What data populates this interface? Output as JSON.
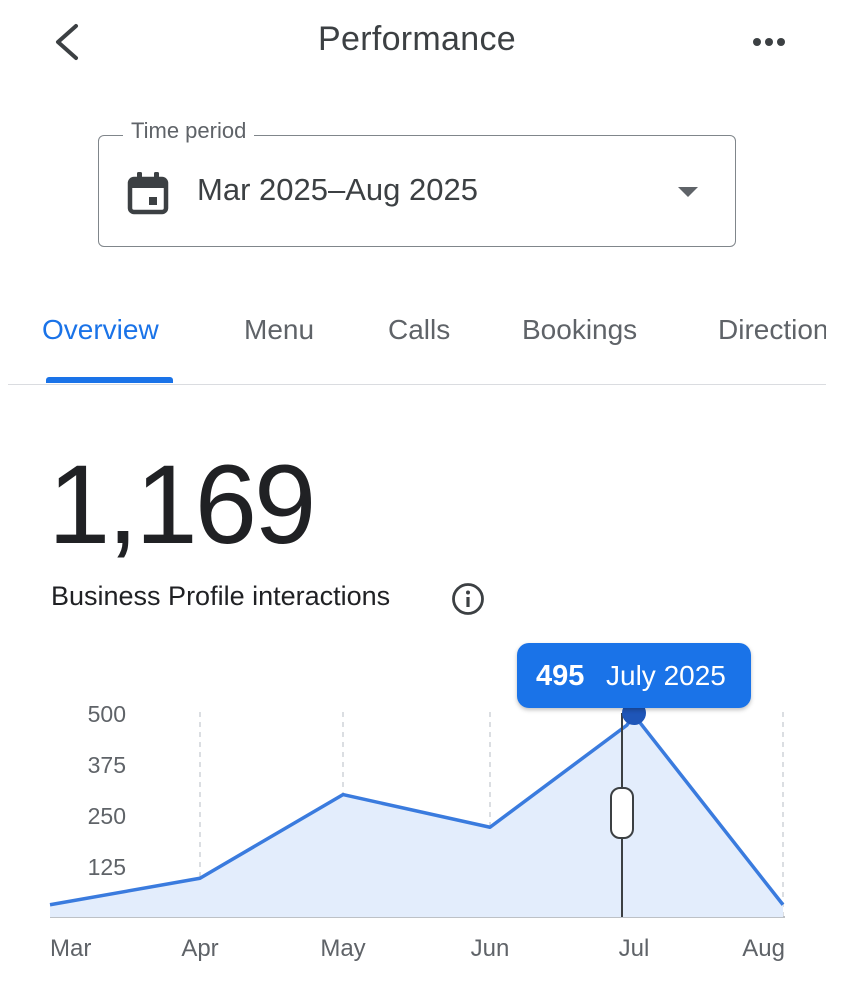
{
  "header": {
    "title": "Performance",
    "back_icon": "chevron-left-icon",
    "more_icon": "more-horizontal-icon"
  },
  "time_period": {
    "label": "Time period",
    "value": "Mar 2025–Aug 2025",
    "icon": "calendar-icon",
    "dropdown_icon": "arrow-drop-down-icon"
  },
  "tabs": [
    {
      "label": "Overview",
      "active": true
    },
    {
      "label": "Menu",
      "active": false
    },
    {
      "label": "Calls",
      "active": false
    },
    {
      "label": "Bookings",
      "active": false
    },
    {
      "label": "Directions",
      "active": false
    }
  ],
  "metric": {
    "value": "1,169",
    "label": "Business Profile interactions",
    "info_icon": "info-icon"
  },
  "tooltip": {
    "value": "495",
    "label": "July 2025"
  },
  "colors": {
    "accent": "#1a73e8",
    "line": "#3a7bde",
    "area": "#e3edfc",
    "grid": "#cfd3d8"
  },
  "chart_data": {
    "type": "area",
    "categories": [
      "Mar",
      "Apr",
      "May",
      "Jun",
      "Jul",
      "Aug"
    ],
    "y_ticks": [
      "500",
      "375",
      "250",
      "125"
    ],
    "ylim": [
      0,
      500
    ],
    "points": [
      {
        "month": 0,
        "value": 30
      },
      {
        "month": 1,
        "value": 95
      },
      {
        "month": 2,
        "value": 300
      },
      {
        "month": 3,
        "value": 220
      },
      {
        "month": 3.95,
        "value": 470
      },
      {
        "month": 4,
        "value": 495
      },
      {
        "month": 5,
        "value": 30
      }
    ],
    "selected": {
      "month": "Jul",
      "value": 495
    },
    "grid": "vertical dashed"
  }
}
